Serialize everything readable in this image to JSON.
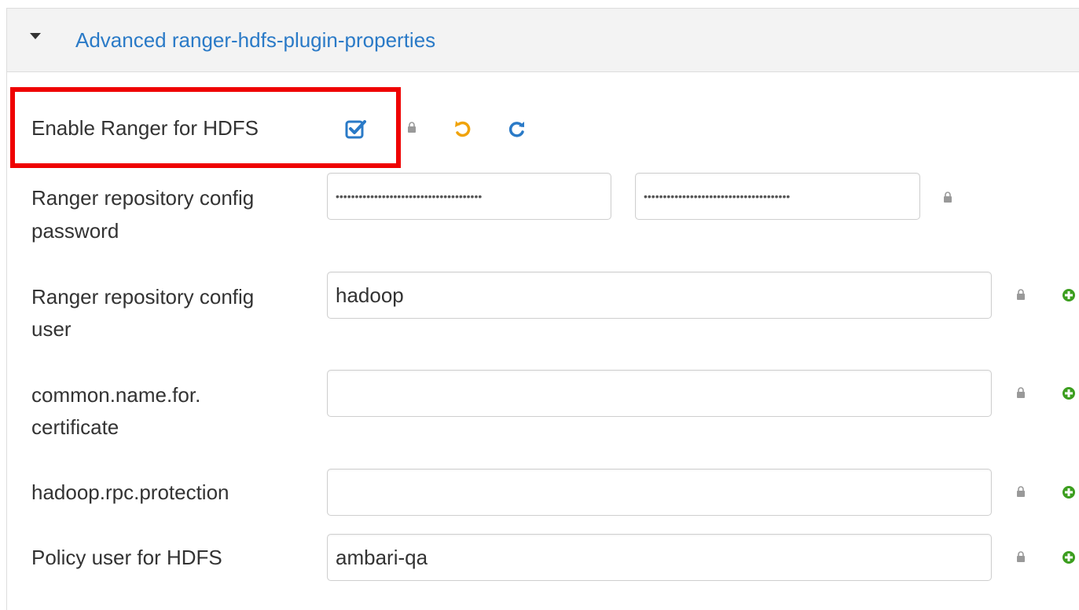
{
  "section": {
    "title": "Advanced ranger-hdfs-plugin-properties",
    "expanded": true
  },
  "properties": {
    "enable_ranger": {
      "label": "Enable Ranger for HDFS",
      "checked": true
    },
    "repo_password": {
      "label_line1": "Ranger repository config",
      "label_line2": "password",
      "value": "••••••••••••••••••••••••••••••••••••••",
      "confirm_value": "••••••••••••••••••••••••••••••••••••••"
    },
    "repo_user": {
      "label_line1": "Ranger repository config",
      "label_line2": "user",
      "value": "hadoop"
    },
    "common_name": {
      "label_line1": "common.name.for.",
      "label_line2": "certificate",
      "value": ""
    },
    "rpc_protection": {
      "label": "hadoop.rpc.protection",
      "value": ""
    },
    "policy_user": {
      "label": "Policy user for HDFS",
      "value": "ambari-qa"
    }
  },
  "colors": {
    "link": "#2a7ac7",
    "undo": "#f0a30a",
    "refresh": "#2a7ac7",
    "add": "#3c9e1f",
    "lock": "#999999",
    "highlight": "#ef0000"
  },
  "icons": {
    "caret": "caret-down-icon",
    "lock": "lock-icon",
    "undo": "undo-icon",
    "refresh": "refresh-icon",
    "add": "plus-circle-icon",
    "checkbox": "checkbox-checked-icon"
  }
}
